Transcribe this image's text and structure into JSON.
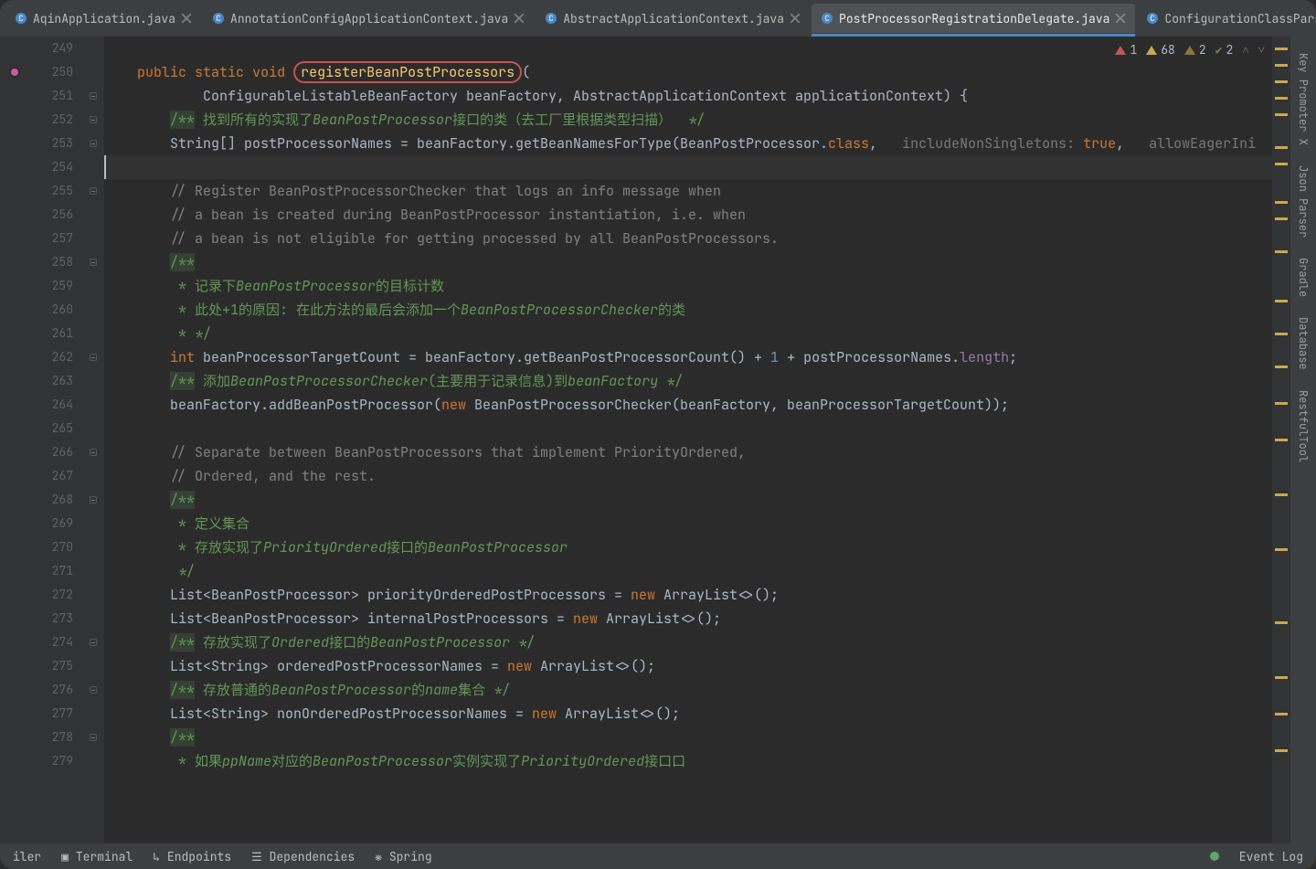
{
  "tabs": [
    {
      "label": "AqinApplication.java",
      "icon": "class"
    },
    {
      "label": "AnnotationConfigApplicationContext.java",
      "icon": "class"
    },
    {
      "label": "AbstractApplicationContext.java",
      "icon": "class"
    },
    {
      "label": "PostProcessorRegistrationDelegate.java",
      "icon": "class",
      "active": true
    },
    {
      "label": "ConfigurationClassParser.j",
      "icon": "class"
    }
  ],
  "inspections": {
    "errors": "1",
    "warnings": "68",
    "weak": "2",
    "ok": "2"
  },
  "line_start": 249,
  "line_end": 279,
  "cursor_line": 254,
  "gutter_icons": {
    "250": "impl-pink"
  },
  "fold_lines": [
    251,
    252,
    253,
    255,
    258,
    262,
    266,
    268,
    274,
    276,
    278
  ],
  "code": {
    "249": [],
    "250": [
      {
        "t": "    "
      },
      {
        "t": "public",
        "c": "kw"
      },
      {
        "t": " "
      },
      {
        "t": "static",
        "c": "kw"
      },
      {
        "t": " "
      },
      {
        "t": "void",
        "c": "kw"
      },
      {
        "t": " "
      },
      {
        "t": "registerBeanPostProcessors",
        "c": "mname circled"
      },
      {
        "t": "(",
        "c": "op"
      }
    ],
    "251": [
      {
        "t": "            "
      },
      {
        "t": "ConfigurableListableBeanFactory beanFactory, AbstractApplicationContext applicationContext) {",
        "c": "type"
      }
    ],
    "252": [
      {
        "t": "        "
      },
      {
        "t": "/**",
        "c": "doc docbg"
      },
      {
        "t": " 找到所有的实现了",
        "c": "doc"
      },
      {
        "t": "BeanPostProcessor",
        "c": "doc",
        "i": true
      },
      {
        "t": "接口的类（去工厂里根据类型扫描）  */",
        "c": "doc"
      }
    ],
    "253": [
      {
        "t": "        "
      },
      {
        "t": "String[] postProcessorNames = beanFactory.getBeanNamesForType(BeanPostProcessor."
      },
      {
        "t": "class",
        "c": "kw"
      },
      {
        "t": ",   "
      },
      {
        "t": "includeNonSingletons:",
        "c": "hint"
      },
      {
        "t": " "
      },
      {
        "t": "true",
        "c": "kw"
      },
      {
        "t": ",   "
      },
      {
        "t": "allowEagerIni",
        "c": "hint"
      }
    ],
    "254": [],
    "255": [
      {
        "t": "        "
      },
      {
        "t": "// Register BeanPostProcessorChecker that logs an info message when",
        "c": "cmt"
      }
    ],
    "256": [
      {
        "t": "        "
      },
      {
        "t": "// a bean is created during BeanPostProcessor instantiation, i.e. when",
        "c": "cmt"
      }
    ],
    "257": [
      {
        "t": "        "
      },
      {
        "t": "// a bean is not eligible for getting processed by all BeanPostProcessors.",
        "c": "cmt"
      }
    ],
    "258": [
      {
        "t": "        "
      },
      {
        "t": "/**",
        "c": "doc docbg"
      }
    ],
    "259": [
      {
        "t": "         * 记录下",
        "c": "doc"
      },
      {
        "t": "BeanPostProcessor",
        "c": "doc",
        "i": true
      },
      {
        "t": "的目标计数",
        "c": "doc"
      }
    ],
    "260": [
      {
        "t": "         * 此处+1的原因: 在此方法的最后会添加一个",
        "c": "doc"
      },
      {
        "t": "BeanPostProcessorChecker",
        "c": "doc",
        "i": true
      },
      {
        "t": "的类",
        "c": "doc"
      }
    ],
    "261": [
      {
        "t": "         * */",
        "c": "doc"
      }
    ],
    "262": [
      {
        "t": "        "
      },
      {
        "t": "int",
        "c": "kw"
      },
      {
        "t": " beanProcessorTargetCount = beanFactory.getBeanPostProcessorCount() + "
      },
      {
        "t": "1",
        "c": "num"
      },
      {
        "t": " + postProcessorNames."
      },
      {
        "t": "length",
        "c": "fld"
      },
      {
        "t": ";"
      }
    ],
    "263": [
      {
        "t": "        "
      },
      {
        "t": "/**",
        "c": "doc docbg"
      },
      {
        "t": " 添加",
        "c": "doc"
      },
      {
        "t": "BeanPostProcessorChecker",
        "c": "doc",
        "i": true
      },
      {
        "t": "(主要用于记录信息)到",
        "c": "doc"
      },
      {
        "t": "beanFactory",
        "c": "doc",
        "i": true
      },
      {
        "t": " */",
        "c": "doc"
      }
    ],
    "264": [
      {
        "t": "        "
      },
      {
        "t": "beanFactory.addBeanPostProcessor("
      },
      {
        "t": "new",
        "c": "kw-new"
      },
      {
        "t": " BeanPostProcessorChecker(beanFactory, beanProcessorTargetCount));"
      }
    ],
    "265": [],
    "266": [
      {
        "t": "        "
      },
      {
        "t": "// Separate between BeanPostProcessors that implement PriorityOrdered,",
        "c": "cmt"
      }
    ],
    "267": [
      {
        "t": "        "
      },
      {
        "t": "// Ordered, and the rest.",
        "c": "cmt"
      }
    ],
    "268": [
      {
        "t": "        "
      },
      {
        "t": "/**",
        "c": "doc docbg"
      }
    ],
    "269": [
      {
        "t": "         * 定义集合",
        "c": "doc"
      }
    ],
    "270": [
      {
        "t": "         * 存放实现了",
        "c": "doc"
      },
      {
        "t": "PriorityOrdered",
        "c": "doc",
        "i": true
      },
      {
        "t": "接口的",
        "c": "doc"
      },
      {
        "t": "BeanPostProcessor",
        "c": "doc",
        "i": true
      }
    ],
    "271": [
      {
        "t": "         */",
        "c": "doc"
      }
    ],
    "272": [
      {
        "t": "        "
      },
      {
        "t": "List<BeanPostProcessor> priorityOrderedPostProcessors = "
      },
      {
        "t": "new",
        "c": "kw-new"
      },
      {
        "t": " ArrayList<>();"
      }
    ],
    "273": [
      {
        "t": "        "
      },
      {
        "t": "List<BeanPostProcessor> internalPostProcessors = "
      },
      {
        "t": "new",
        "c": "kw-new"
      },
      {
        "t": " ArrayList<>();"
      }
    ],
    "274": [
      {
        "t": "        "
      },
      {
        "t": "/**",
        "c": "doc docbg"
      },
      {
        "t": " 存放实现了",
        "c": "doc"
      },
      {
        "t": "Ordered",
        "c": "doc",
        "i": true
      },
      {
        "t": "接口的",
        "c": "doc"
      },
      {
        "t": "BeanPostProcessor",
        "c": "doc",
        "i": true
      },
      {
        "t": " */",
        "c": "doc"
      }
    ],
    "275": [
      {
        "t": "        "
      },
      {
        "t": "List<String> orderedPostProcessorNames = "
      },
      {
        "t": "new",
        "c": "kw-new"
      },
      {
        "t": " ArrayList<>();"
      }
    ],
    "276": [
      {
        "t": "        "
      },
      {
        "t": "/**",
        "c": "doc docbg"
      },
      {
        "t": " 存放普通的",
        "c": "doc"
      },
      {
        "t": "BeanPostProcessor",
        "c": "doc",
        "i": true
      },
      {
        "t": "的",
        "c": "doc"
      },
      {
        "t": "name",
        "c": "doc",
        "i": true
      },
      {
        "t": "集合 */",
        "c": "doc"
      }
    ],
    "277": [
      {
        "t": "        "
      },
      {
        "t": "List<String> nonOrderedPostProcessorNames = "
      },
      {
        "t": "new",
        "c": "kw-new"
      },
      {
        "t": " ArrayList<>();"
      }
    ],
    "278": [
      {
        "t": "        "
      },
      {
        "t": "/**",
        "c": "doc docbg"
      }
    ],
    "279": [
      {
        "t": "         * 如果",
        "c": "doc"
      },
      {
        "t": "ppName",
        "c": "doc",
        "i": true
      },
      {
        "t": "对应的",
        "c": "doc"
      },
      {
        "t": "BeanPostProcessor",
        "c": "doc",
        "i": true
      },
      {
        "t": "实例实现了",
        "c": "doc"
      },
      {
        "t": "PriorityOrdered",
        "c": "doc",
        "i": true
      },
      {
        "t": "接口口",
        "c": "doc"
      }
    ]
  },
  "right_tools": [
    "Key Promoter X",
    "Json Parser",
    "Gradle",
    "Database",
    "RestfulTool"
  ],
  "stripe_marks": [
    12,
    30,
    48,
    66,
    84,
    120,
    138,
    180,
    198,
    234,
    288,
    324,
    360,
    400,
    440,
    500,
    560,
    640,
    700,
    740,
    780
  ],
  "bottom": {
    "left_trunc": "iler",
    "terminal": "Terminal",
    "endpoints": "Endpoints",
    "dependencies": "Dependencies",
    "spring": "Spring",
    "event_log": "Event Log"
  }
}
